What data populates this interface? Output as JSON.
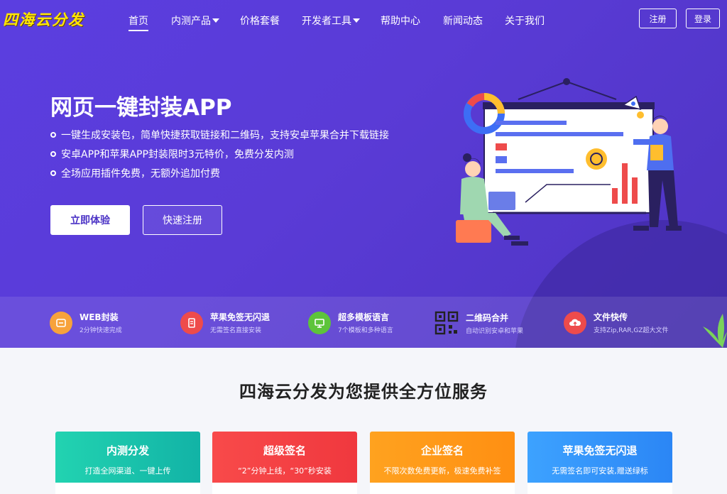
{
  "brand": {
    "logo_text": "四海云分发"
  },
  "nav": {
    "items": [
      {
        "label": "首页",
        "dropdown": false,
        "active": true
      },
      {
        "label": "内测产品",
        "dropdown": true,
        "active": false
      },
      {
        "label": "价格套餐",
        "dropdown": false,
        "active": false
      },
      {
        "label": "开发者工具",
        "dropdown": true,
        "active": false
      },
      {
        "label": "帮助中心",
        "dropdown": false,
        "active": false
      },
      {
        "label": "新闻动态",
        "dropdown": false,
        "active": false
      },
      {
        "label": "关于我们",
        "dropdown": false,
        "active": false
      }
    ],
    "register_label": "注册",
    "login_label": "登录"
  },
  "hero": {
    "title": "网页一键封装APP",
    "features": [
      "一键生成安装包，简单快捷获取链接和二维码，支持安卓苹果合并下载链接",
      "安卓APP和苹果APP封装限时3元特价，免费分发内测",
      "全场应用插件免费，无额外追加付费"
    ],
    "try_label": "立即体验",
    "register_label": "快速注册"
  },
  "strip": [
    {
      "title": "WEB封装",
      "desc": "2分钟快速完成",
      "icon": "web-wrap-icon",
      "color": "#f7a23b"
    },
    {
      "title": "苹果免签无闪退",
      "desc": "无需签名直接安装",
      "icon": "apple-nosign-icon",
      "color": "#ee4b4b"
    },
    {
      "title": "超多模板语言",
      "desc": "7个模板和多种语言",
      "icon": "template-icon",
      "color": "#5dc43a"
    },
    {
      "title": "二维码合并",
      "desc": "自动识别安卓和苹果",
      "icon": "qrcode-icon",
      "color": "#333333"
    },
    {
      "title": "文件快传",
      "desc": "支持Zip,RAR,GZ超大文件",
      "icon": "cloud-upload-icon",
      "color": "#ee4b4b"
    }
  ],
  "services": {
    "title": "四海云分发为您提供全方位服务",
    "cards": [
      {
        "title": "内测分发",
        "subtitle": "打造全网渠道、一键上传",
        "color_from": "#22d3b1",
        "color_to": "#12b3a6"
      },
      {
        "title": "超级签名",
        "subtitle": "“2”分钟上线，“30”秒安装",
        "color_from": "#f84a4a",
        "color_to": "#f0383e"
      },
      {
        "title": "企业签名",
        "subtitle": "不限次数免费更新，极速免费补签",
        "color_from": "#ffa21f",
        "color_to": "#ff8f12"
      },
      {
        "title": "苹果免签无闪退",
        "subtitle": "无需签名即可安装,赠送绿标",
        "color_from": "#3da2ff",
        "color_to": "#2b86f5"
      }
    ]
  }
}
